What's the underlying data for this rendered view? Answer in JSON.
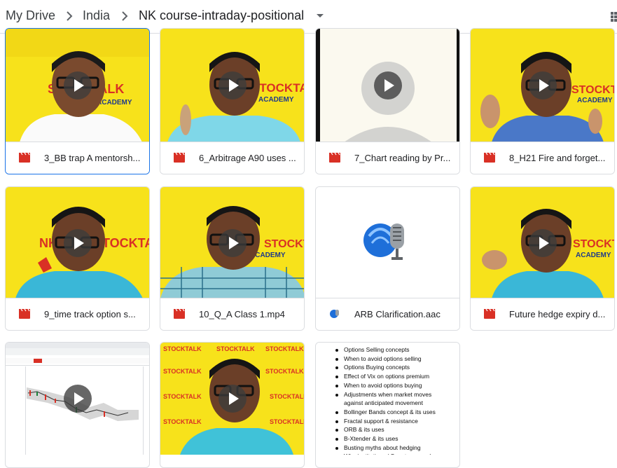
{
  "breadcrumb": {
    "items": [
      "My Drive",
      "India",
      "NK course-intraday-positional"
    ]
  },
  "overlay_texts": {
    "stocktalk": "STOCKTALK",
    "academy": "ACADEMY",
    "nk": "NK",
    "stocktalk_short": "STOCKTAL"
  },
  "files": [
    {
      "name": "3_BB trap A mentorsh...",
      "icon": "video-file-icon",
      "type": "video"
    },
    {
      "name": "6_Arbitrage A90 uses ...",
      "icon": "video-file-icon",
      "type": "video"
    },
    {
      "name": "7_Chart reading by Pr...",
      "icon": "video-file-icon",
      "type": "video"
    },
    {
      "name": "8_H21 Fire and forget...",
      "icon": "video-file-icon",
      "type": "video"
    },
    {
      "name": "9_time track option s...",
      "icon": "video-file-icon",
      "type": "video"
    },
    {
      "name": "10_Q_A Class 1.mp4",
      "icon": "video-file-icon",
      "type": "video"
    },
    {
      "name": "ARB Clarification.aac",
      "icon": "audio-file-icon",
      "type": "audio"
    },
    {
      "name": "Future hedge expiry d...",
      "icon": "video-file-icon",
      "type": "video"
    }
  ],
  "document_preview": {
    "lines": [
      "Options Selling concepts",
      "When to avoid options selling",
      "Options Buying concepts",
      "Effect of Vix on options premium",
      "When to avoid options buying",
      "Adjustments when market moves",
      "against anticipated movement",
      "Bollinger Bands concept & its uses",
      "Fractal support & resistance",
      "ORB & its uses",
      "B-Xtender & its uses",
      "Busting myths about hedging",
      "Why institutions / Smart money do"
    ]
  },
  "colors": {
    "accent": "#1a73e8",
    "thumb_yellow": "#f7e21b",
    "video_icon": "#d93025"
  }
}
